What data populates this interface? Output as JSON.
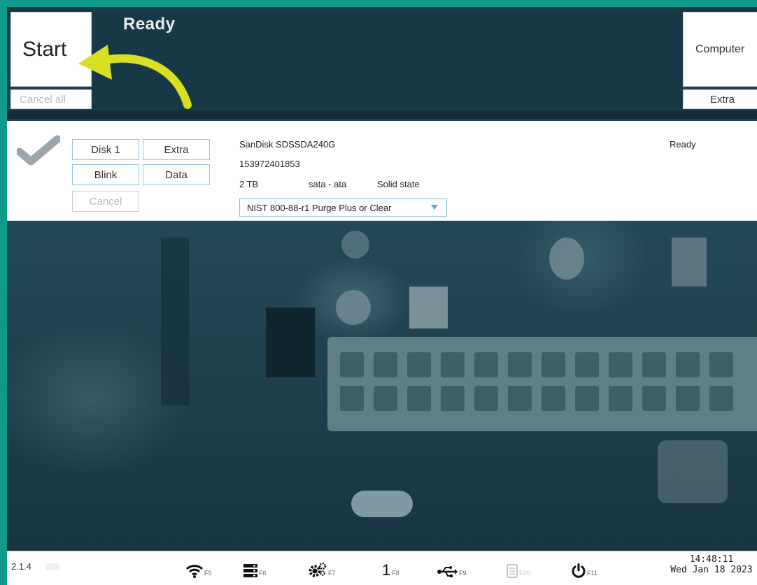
{
  "header": {
    "start_label": "Start",
    "cancel_all_label": "Cancel all",
    "status": "Ready",
    "computer_label": "Computer",
    "extra_label": "Extra"
  },
  "disk": {
    "disk_label": "Disk 1",
    "extra_label": "Extra",
    "blink_label": "Blink",
    "data_label": "Data",
    "cancel_label": "Cancel",
    "model": "SanDisk SDSSDA240G",
    "serial": "153972401853",
    "capacity": "2 TB",
    "interface": "sata - ata",
    "type": "Solid state",
    "status": "Ready",
    "erase_method": "NIST 800-88-r1 Purge Plus or Clear"
  },
  "taskbar": {
    "version": "2.1.4",
    "items": [
      {
        "icon": "wifi-icon",
        "key": "F5"
      },
      {
        "icon": "server-icon",
        "key": "F6"
      },
      {
        "icon": "gears-icon",
        "key": "F7"
      },
      {
        "icon": "one-icon",
        "glyph": "1",
        "key": "F8"
      },
      {
        "icon": "usb-icon",
        "key": "F9"
      },
      {
        "icon": "document-icon",
        "key": "F10"
      },
      {
        "icon": "power-icon",
        "key": "F11"
      }
    ],
    "time": "14:48:11",
    "date": "Wed Jan 18 2023"
  },
  "colors": {
    "frame": "#0f9a8a",
    "status_panel": "#163847",
    "accent_outline": "#8fc6e2",
    "hint_arrow": "#d8e021"
  }
}
